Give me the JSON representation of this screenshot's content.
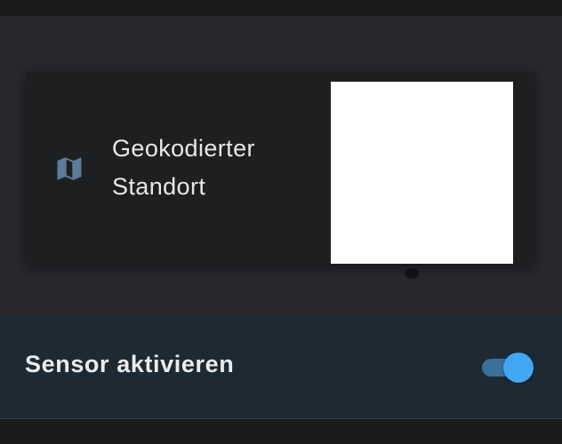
{
  "card": {
    "title_line1": "Geokodierter",
    "title_line2": "Standort",
    "icon": "map-icon",
    "icon_color": "#5d7b9a"
  },
  "sensor": {
    "label": "Sensor aktivieren",
    "enabled": true,
    "accent_color": "#41a6f4"
  }
}
